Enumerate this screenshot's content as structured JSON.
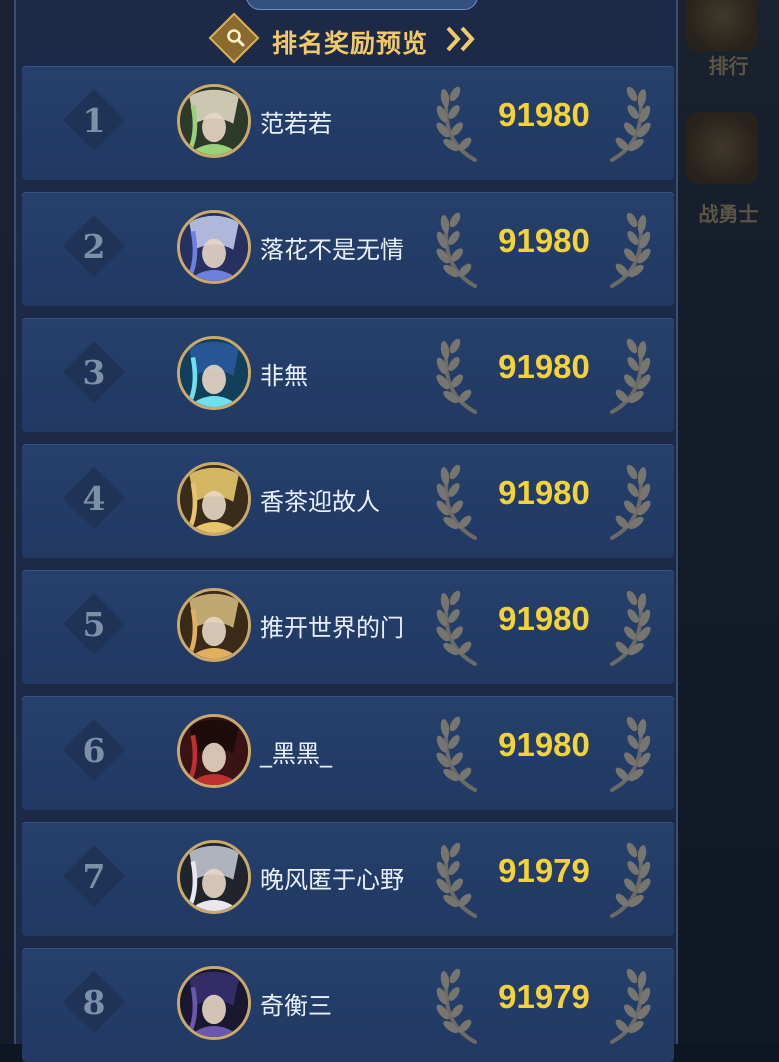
{
  "header": {
    "title": "排名奖励预览"
  },
  "side": {
    "rank_label": "排行",
    "warrior_label": "战勇士"
  },
  "colors": {
    "accent_gold": "#f2c96a",
    "score_yellow": "#f4d23a",
    "row_bg": "#26406c"
  },
  "rows": [
    {
      "rank": "1",
      "name": "范若若",
      "score": "91980",
      "avatar": {
        "bg": "#2d3a2a",
        "fg": "#9ccf7a",
        "hair": "#e8e0c8"
      }
    },
    {
      "rank": "2",
      "name": "落花不是无情",
      "score": "91980",
      "avatar": {
        "bg": "#27305f",
        "fg": "#6f7fe0",
        "hair": "#c8d0f0"
      }
    },
    {
      "rank": "3",
      "name": "非無",
      "score": "91980",
      "avatar": {
        "bg": "#12405a",
        "fg": "#6fe0f0",
        "hair": "#2a5aa0"
      }
    },
    {
      "rank": "4",
      "name": "香茶迎故人",
      "score": "91980",
      "avatar": {
        "bg": "#3a2c1a",
        "fg": "#e8c46a",
        "hair": "#f0d070"
      }
    },
    {
      "rank": "5",
      "name": "推开世界的门",
      "score": "91980",
      "avatar": {
        "bg": "#3a2a18",
        "fg": "#e0b060",
        "hair": "#d8c080"
      }
    },
    {
      "rank": "6",
      "name": "_黑黑_",
      "score": "91980",
      "avatar": {
        "bg": "#3a1414",
        "fg": "#c03030",
        "hair": "#1a0a0a"
      }
    },
    {
      "rank": "7",
      "name": "晚风匿于心野",
      "score": "91979",
      "avatar": {
        "bg": "#20242c",
        "fg": "#e8e8ee",
        "hair": "#c8ccd8"
      }
    },
    {
      "rank": "8",
      "name": "奇衡三",
      "score": "91979",
      "avatar": {
        "bg": "#1a1830",
        "fg": "#6a58b0",
        "hair": "#3a3070"
      }
    }
  ]
}
